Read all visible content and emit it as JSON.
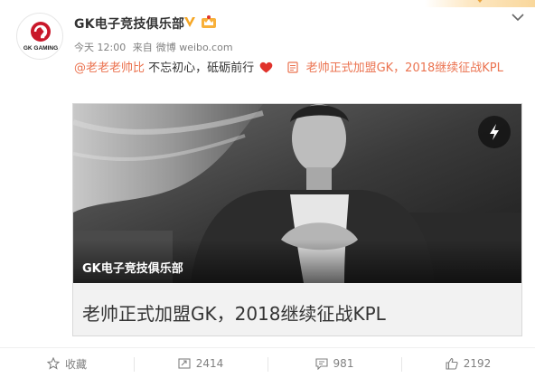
{
  "post": {
    "avatar_label": "GK GAMING",
    "username": "GK电子竞技俱乐部",
    "meta": {
      "time": "今天 12:00",
      "via_prefix": "来自",
      "via": "微博 weibo.com"
    },
    "text": {
      "mention": "@老老老帅比",
      "body": " 不忘初心，砥砺前行",
      "link": "老帅正式加盟GK，2018继续征战KPL"
    },
    "card": {
      "overlay_title": "GK电子竞技俱乐部",
      "caption": "老帅正式加盟GK，2018继续征战KPL"
    }
  },
  "actions": [
    {
      "name": "favorite",
      "label": "收藏",
      "icon": "star-icon"
    },
    {
      "name": "repost",
      "label": "2414",
      "icon": "repost-icon"
    },
    {
      "name": "comment",
      "label": "981",
      "icon": "comment-icon"
    },
    {
      "name": "like",
      "label": "2192",
      "icon": "thumbs-up-icon"
    }
  ],
  "colors": {
    "accent": "#eb7350",
    "verified": "#f6a623",
    "heart": "#e0322b",
    "text": "#333333",
    "muted": "#808080"
  }
}
